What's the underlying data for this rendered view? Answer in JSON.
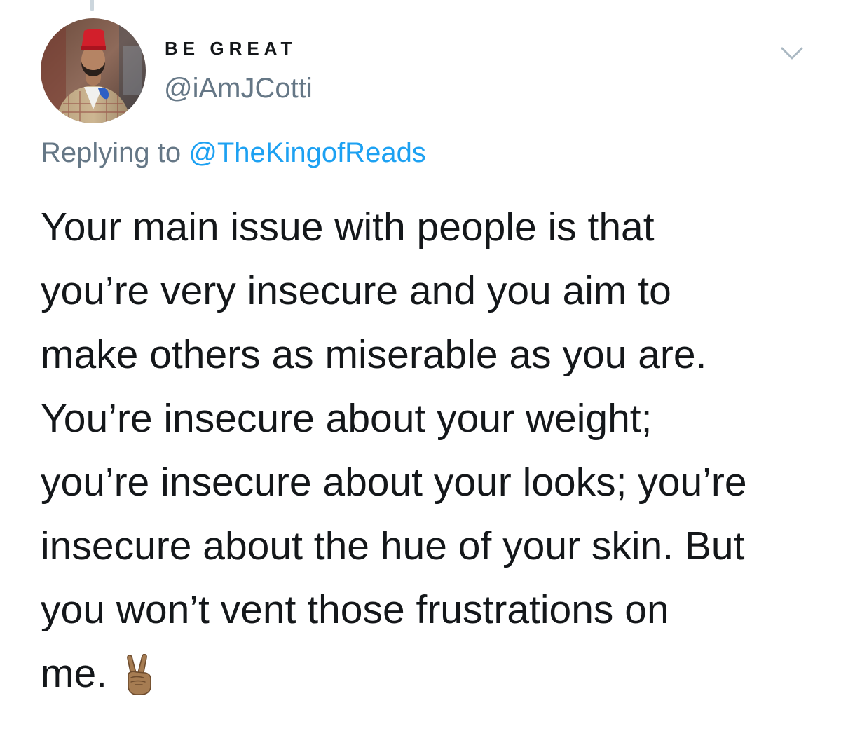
{
  "author": {
    "display_name": "BE GREAT",
    "handle": "@iAmJCotti"
  },
  "reply": {
    "prefix": "Replying to ",
    "mention": "@TheKingofReads"
  },
  "tweet": {
    "lines": [
      "Your main issue with people is that",
      "you’re very insecure and you aim to",
      "make others as miserable as you are.",
      "You’re insecure about your weight;",
      "you’re insecure about your looks; you’re",
      "insecure about the hue of your skin. But",
      "you won’t vent those frustrations on",
      "me."
    ],
    "emoji": "victory-hand-medium-dark-skin-tone"
  },
  "icons": {
    "menu": "chevron-down-icon",
    "avatar": "profile-photo"
  },
  "colors": {
    "text_primary": "#14171a",
    "text_secondary": "#657786",
    "link": "#1da1f2",
    "background": "#ffffff"
  }
}
